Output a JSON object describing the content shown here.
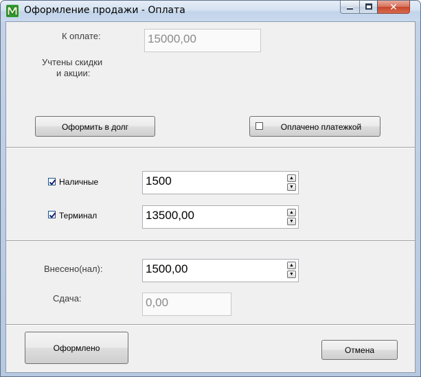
{
  "window": {
    "title": "Оформление продажи - Оплата",
    "min_glyph": "",
    "close_glyph": "✕"
  },
  "payment": {
    "to_pay_label": "К оплате:",
    "to_pay_value": "15000,00",
    "discounts_line1": "Учтены скидки",
    "discounts_line2": "и акции:"
  },
  "buttons": {
    "debt": "Оформить в долг",
    "paid_by_order": "Оплачено платежкой",
    "done": "Оформлено",
    "cancel": "Отмена"
  },
  "methods": {
    "cash_label": "Наличные",
    "cash_checked": true,
    "cash_value": "1500",
    "terminal_label": "Терминал",
    "terminal_checked": true,
    "terminal_value": "13500,00",
    "paid_by_order_checked": false
  },
  "change": {
    "deposited_label": "Внесено(нал):",
    "deposited_value": "1500,00",
    "change_label": "Сдача:",
    "change_value": "0,00"
  },
  "icons": {
    "app": "app-logo-icon",
    "spin_up": "▲",
    "spin_down": "▼"
  }
}
